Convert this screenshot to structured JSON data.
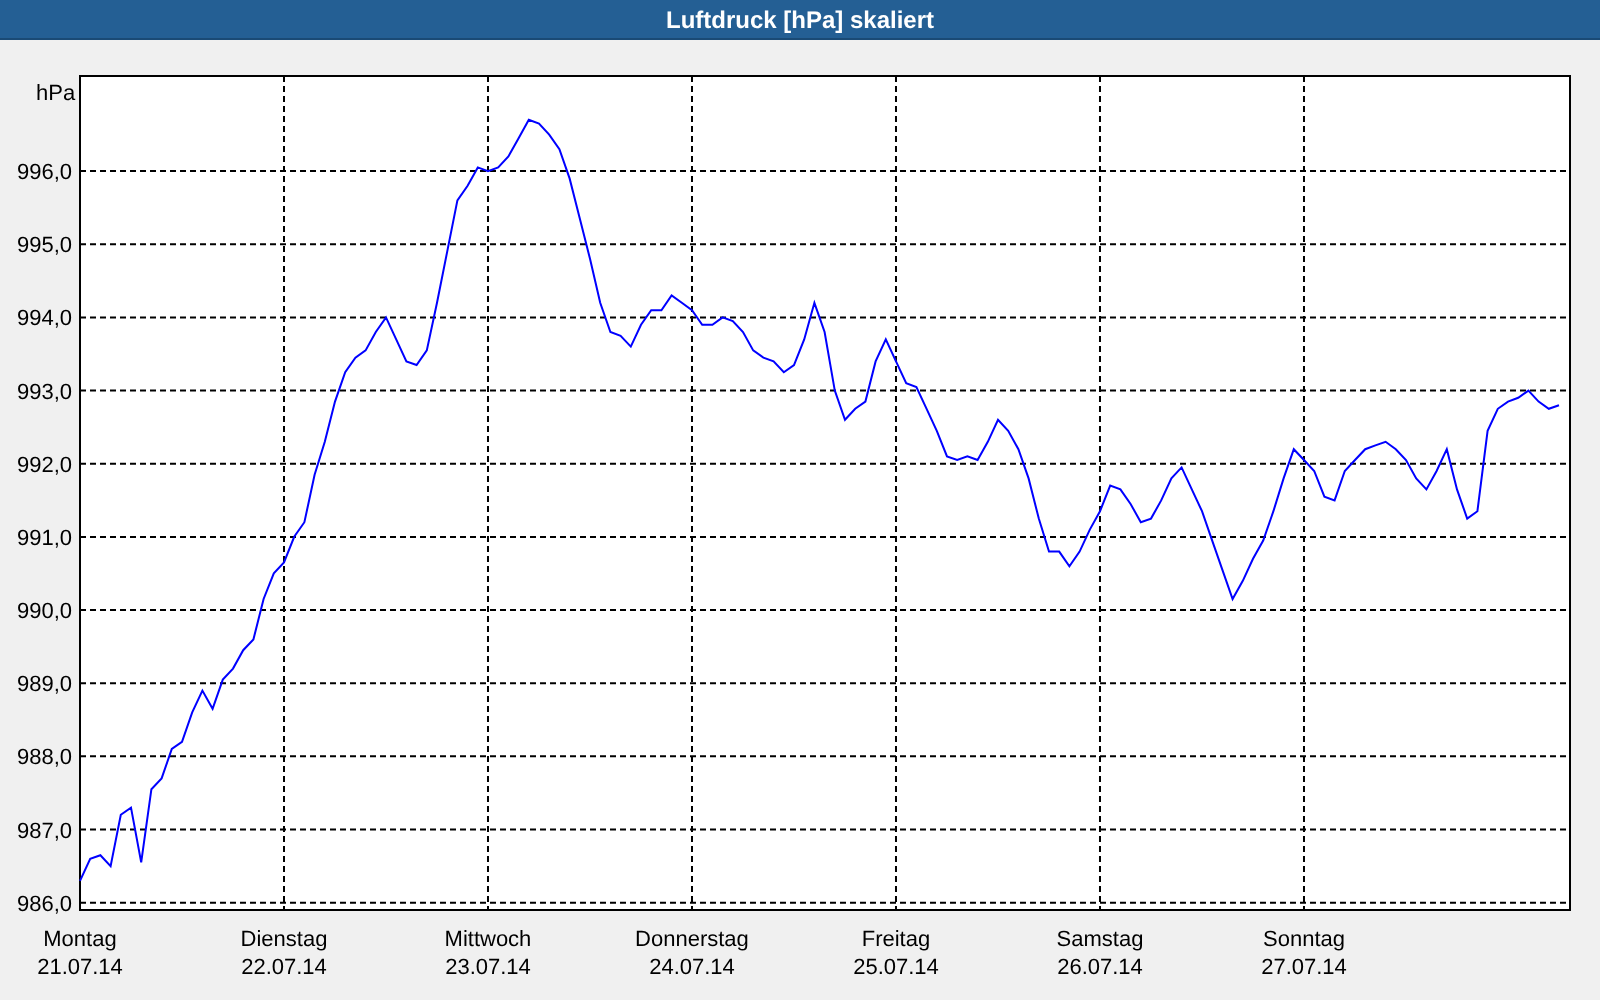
{
  "window": {
    "title": "Luftdruck [hPa] skaliert"
  },
  "chart": {
    "chart_data": {
      "type": "line",
      "ylabel": "hPa",
      "categories": [
        "Montag 21.07.14",
        null,
        null,
        null,
        null,
        null,
        null,
        null,
        null,
        null,
        null,
        null,
        null,
        null,
        null,
        null,
        null,
        null,
        null,
        null,
        "Dienstag 22.07.14",
        null,
        null,
        null,
        null,
        null,
        null,
        null,
        null,
        null,
        null,
        null,
        null,
        null,
        null,
        null,
        null,
        null,
        null,
        null,
        "Mittwoch 23.07.14",
        null,
        null,
        null,
        null,
        null,
        null,
        null,
        null,
        null,
        null,
        null,
        null,
        null,
        null,
        null,
        null,
        null,
        null,
        null,
        "Donnerstag 24.07.14",
        null,
        null,
        null,
        null,
        null,
        null,
        null,
        null,
        null,
        null,
        null,
        null,
        null,
        null,
        null,
        null,
        null,
        null,
        null,
        "Freitag 25.07.14",
        null,
        null,
        null,
        null,
        null,
        null,
        null,
        null,
        null,
        null,
        null,
        null,
        null,
        null,
        null,
        null,
        null,
        null,
        null,
        "Samstag 26.07.14",
        null,
        null,
        null,
        null,
        null,
        null,
        null,
        null,
        null,
        null,
        null,
        null,
        null,
        null,
        null,
        null,
        null,
        null,
        null,
        "Sonntag 27.07.14",
        null,
        null,
        null,
        null,
        null,
        null,
        null,
        null,
        null,
        null,
        null,
        null,
        null,
        null,
        null,
        null,
        null,
        null,
        null,
        null,
        null,
        null,
        null,
        null,
        null
      ],
      "series": [
        {
          "color": "#0000ff",
          "values": [
            986.3,
            986.6,
            986.65,
            986.5,
            987.2,
            987.3,
            986.55,
            987.55,
            987.7,
            988.1,
            988.2,
            988.6,
            988.9,
            988.65,
            989.05,
            989.2,
            989.45,
            989.6,
            990.15,
            990.5,
            990.65,
            991.0,
            991.2,
            991.85,
            992.3,
            992.85,
            993.25,
            993.45,
            993.55,
            993.8,
            994.0,
            993.7,
            993.4,
            993.35,
            993.55,
            994.2,
            994.9,
            995.6,
            995.8,
            996.05,
            996.0,
            996.05,
            996.2,
            996.45,
            996.7,
            996.65,
            996.5,
            996.3,
            995.9,
            995.35,
            994.8,
            994.2,
            993.8,
            993.75,
            993.6,
            993.9,
            994.1,
            994.1,
            994.3,
            994.2,
            994.1,
            993.9,
            993.9,
            994.0,
            993.95,
            993.8,
            993.55,
            993.45,
            993.4,
            993.25,
            993.35,
            993.7,
            994.2,
            993.8,
            993.0,
            992.6,
            992.75,
            992.85,
            993.4,
            993.7,
            993.4,
            993.1,
            993.05,
            992.75,
            992.45,
            992.1,
            992.05,
            992.1,
            992.05,
            992.3,
            992.6,
            992.45,
            992.2,
            991.8,
            991.25,
            990.8,
            990.8,
            990.6,
            990.8,
            991.1,
            991.35,
            991.7,
            991.65,
            991.45,
            991.2,
            991.25,
            991.5,
            991.8,
            991.95,
            991.65,
            991.35,
            990.95,
            990.55,
            990.15,
            990.4,
            990.7,
            990.95,
            991.35,
            991.8,
            992.2,
            992.05,
            991.9,
            991.55,
            991.5,
            991.9,
            992.05,
            992.2,
            992.25,
            992.3,
            992.2,
            992.05,
            991.8,
            991.65,
            991.9,
            992.2,
            991.65,
            991.25,
            991.35,
            992.45,
            992.75,
            992.85,
            992.9,
            993.0,
            992.85,
            992.75,
            992.8
          ]
        }
      ],
      "grid": true,
      "ylim": [
        985.9,
        997.3
      ],
      "yticks": [
        {
          "value": 986,
          "label": "986,0"
        },
        {
          "value": 987,
          "label": "987,0"
        },
        {
          "value": 988,
          "label": "988,0"
        },
        {
          "value": 989,
          "label": "989,0"
        },
        {
          "value": 990,
          "label": "990,0"
        },
        {
          "value": 991,
          "label": "991,0"
        },
        {
          "value": 992,
          "label": "992,0"
        },
        {
          "value": 993,
          "label": "993,0"
        },
        {
          "value": 994,
          "label": "994,0"
        },
        {
          "value": 995,
          "label": "995,0"
        },
        {
          "value": 996,
          "label": "996,0"
        }
      ]
    }
  }
}
